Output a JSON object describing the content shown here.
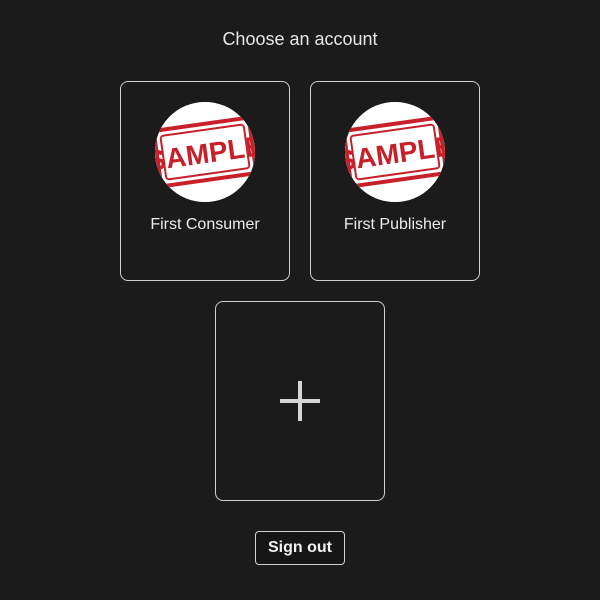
{
  "page": {
    "title": "Choose an account"
  },
  "accounts": [
    {
      "name": "First Consumer",
      "avatar_stamp_text": "SAMPLE"
    },
    {
      "name": "First Publisher",
      "avatar_stamp_text": "SAMPLE"
    }
  ],
  "add_account": {
    "icon": "plus-icon"
  },
  "actions": {
    "sign_out_label": "Sign out"
  },
  "colors": {
    "background": "#1b1b1b",
    "border": "#cfcfcf",
    "stamp_red": "#c8202a"
  }
}
